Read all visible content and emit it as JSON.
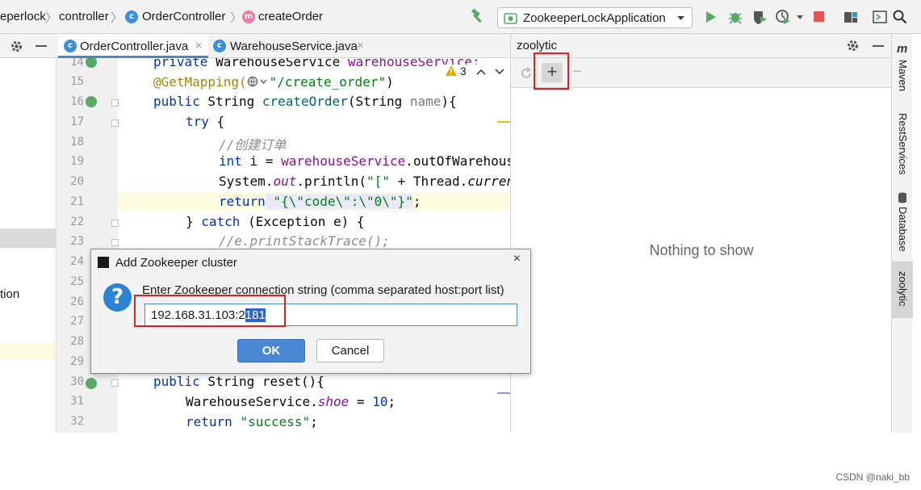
{
  "breadcrumb": {
    "items": [
      {
        "label": "eperlock"
      },
      {
        "label": "controller"
      },
      {
        "label": "OrderController",
        "icon": "class-icon"
      },
      {
        "label": "createOrder",
        "icon": "method-icon"
      }
    ],
    "separator": "〉"
  },
  "run_config": {
    "label": "ZookeeperLockApplication"
  },
  "icons": {
    "class_letter": "c",
    "method_letter": "m",
    "maven_letter": "m",
    "plus": "+",
    "minus": "−",
    "close": "×",
    "question": "?"
  },
  "tabs": [
    {
      "label": "OrderController.java",
      "active": true
    },
    {
      "label": "WarehouseService.java",
      "active": false
    }
  ],
  "left_panel": {
    "text": "tion"
  },
  "editor": {
    "warnings": "3",
    "lines": [
      {
        "num": "14"
      },
      {
        "num": "15"
      },
      {
        "num": "16"
      },
      {
        "num": "17"
      },
      {
        "num": "18"
      },
      {
        "num": "19"
      },
      {
        "num": "20"
      },
      {
        "num": "21"
      },
      {
        "num": "22"
      },
      {
        "num": "23"
      },
      {
        "num": "24"
      },
      {
        "num": "25"
      },
      {
        "num": "26"
      },
      {
        "num": "27"
      },
      {
        "num": "28"
      },
      {
        "num": "29"
      },
      {
        "num": "30"
      },
      {
        "num": "31"
      },
      {
        "num": "32"
      }
    ],
    "code": {
      "l14_kw": "private",
      "l14_type": " WarehouseService ",
      "l14_field": "warehouseService;",
      "l15_anno": "@GetMapping(",
      "l15_path": "\"/create_order\"",
      "l15_close": ")",
      "l16_kw": "public",
      "l16_rest": " String ",
      "l16_method": "createOrder",
      "l16_args_a": "(String ",
      "l16_param": "name",
      "l16_args_b": "){",
      "l17_kw": "try",
      "l17_rest": " {",
      "l18_cmt": "//创建订单",
      "l19_kw": "int",
      "l19_a": " i = ",
      "l19_field": "warehouseService",
      "l19_b": ".outOfWarehouse();",
      "l20_a": "System.",
      "l20_out": "out",
      "l20_b": ".println(",
      "l20_str": "\"[\"",
      "l20_c": " + Thread.",
      "l20_curr": "currentThread()",
      "l21_kw": "return",
      "l21_str": " \"{\\\"code\\\":\\\"0\\\"}\"",
      "l21_end": ";",
      "l22_a": "} ",
      "l22_kw": "catch",
      "l22_b": " (Exception e) {",
      "l23_cmt": "//e.printStackTrace();",
      "l30_kw": "public",
      "l30_rest": " String reset(){",
      "l31_a": "WarehouseService.",
      "l31_field": "shoe",
      "l31_b": " = ",
      "l31_num": "10",
      "l31_c": ";",
      "l32_kw": "return",
      "l32_str": " \"success\"",
      "l32_end": ";"
    }
  },
  "right_panel": {
    "title": "zoolytic",
    "empty_text": "Nothing to show"
  },
  "right_sidebar": [
    {
      "label": "Maven"
    },
    {
      "label": "RestServices"
    },
    {
      "label": "Database"
    },
    {
      "label": "zoolytic"
    }
  ],
  "dialog": {
    "title": "Add Zookeeper cluster",
    "message": "Enter Zookeeper connection string (comma separated host:port list)",
    "input_value_plain": "192.168.31.103:2",
    "input_value_selected": "181",
    "ok_label": "OK",
    "cancel_label": "Cancel"
  },
  "watermark": "CSDN @naki_bb",
  "colors": {
    "accent": "#4a88c7",
    "highlight_red": "#e02020",
    "run_green": "#59a869",
    "stop_red": "#e05555"
  }
}
